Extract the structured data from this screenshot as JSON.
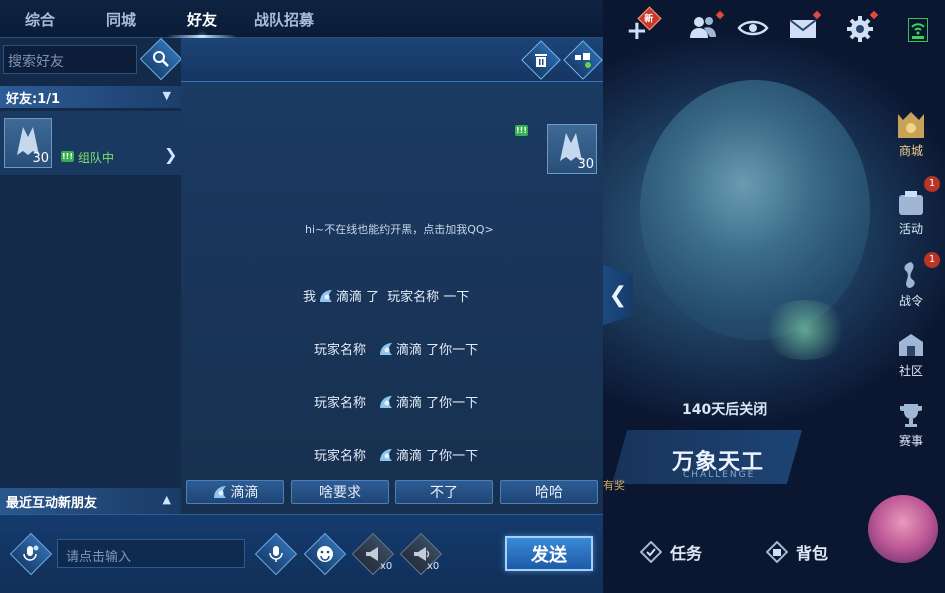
{
  "tabs": [
    {
      "label": "综合",
      "active": false
    },
    {
      "label": "同城",
      "active": false
    },
    {
      "label": "好友",
      "active": true
    },
    {
      "label": "战队招募",
      "active": false
    }
  ],
  "sidebar": {
    "search_placeholder": "搜索好友",
    "friends_header": "好友:1/1",
    "friend": {
      "level": "30",
      "status": "组队中"
    },
    "recent_header": "最近互动新朋友"
  },
  "chat": {
    "partner_level": "30",
    "notice": "hi~不在线也能约开黑，点击加我QQ>",
    "messages": [
      {
        "pre": "我",
        "action": "滴滴 了",
        "post": "玩家名称  一下"
      },
      {
        "pre": "玩家名称",
        "action": "滴滴 了你一下",
        "post": ""
      },
      {
        "pre": "玩家名称",
        "action": "滴滴 了你一下",
        "post": ""
      },
      {
        "pre": "玩家名称",
        "action": "滴滴 了你一下",
        "post": ""
      }
    ],
    "quick_replies": [
      "滴滴",
      "啥要求",
      "不了",
      "哈哈"
    ]
  },
  "input": {
    "placeholder": "请点击输入",
    "send_label": "发送",
    "dim_tool_counts": [
      "x0",
      "x0"
    ]
  },
  "hud": {
    "new_badge": "新",
    "side": [
      {
        "label": "商城",
        "count": ""
      },
      {
        "label": "活动",
        "count": "1"
      },
      {
        "label": "战令",
        "count": "1"
      },
      {
        "label": "社区",
        "count": ""
      },
      {
        "label": "赛事",
        "count": ""
      }
    ],
    "event_days": "140天后关闭",
    "event_title": "万象天工",
    "event_sub": "CHALLENGE",
    "event_reward": "有奖",
    "bottom_buttons": [
      "任务",
      "背包"
    ]
  },
  "colors": {
    "accent": "#3a8ad8",
    "status_green": "#7fe36a",
    "badge_red": "#c8392b"
  }
}
